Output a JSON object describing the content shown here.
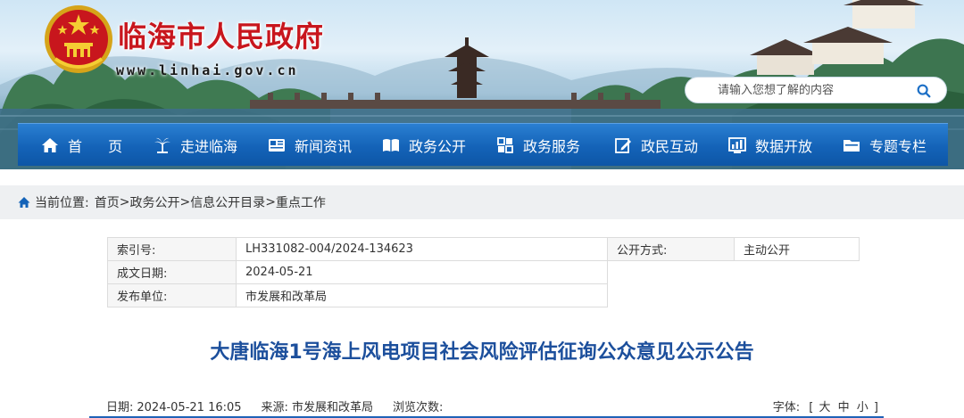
{
  "header": {
    "site_title": "临海市人民政府",
    "site_url": "www.linhai.gov.cn",
    "search": {
      "placeholder": "请输入您想了解的内容"
    }
  },
  "nav": {
    "items": [
      {
        "label": "首 页",
        "icon": "home-icon"
      },
      {
        "label": "走进临海",
        "icon": "palm-tree-icon"
      },
      {
        "label": "新闻资讯",
        "icon": "newspaper-icon"
      },
      {
        "label": "政务公开",
        "icon": "open-book-icon"
      },
      {
        "label": "政务服务",
        "icon": "service-grid-icon"
      },
      {
        "label": "政民互动",
        "icon": "edit-icon"
      },
      {
        "label": "数据开放",
        "icon": "chart-icon"
      },
      {
        "label": "专题专栏",
        "icon": "folder-icon"
      }
    ]
  },
  "breadcrumb": {
    "prefix": "当前位置:",
    "items": [
      "首页",
      "政务公开",
      "信息公开目录",
      "重点工作"
    ],
    "separator": ">"
  },
  "meta": {
    "index_label": "索引号:",
    "index_value": "LH331082-004/2024-134623",
    "public_mode_label": "公开方式:",
    "public_mode_value": "主动公开",
    "date_label": "成文日期:",
    "date_value": "2024-05-21",
    "publisher_label": "发布单位:",
    "publisher_value": "市发展和改革局"
  },
  "article": {
    "title": "大唐临海1号海上风电项目社会风险评估征询公众意见公示公告",
    "date_label": "日期:",
    "date_value": "2024-05-21 16:05",
    "source_label": "来源:",
    "source_value": "市发展和改革局",
    "views_label": "浏览次数:",
    "font_label": "字体:",
    "font_open": "[",
    "font_large": "大",
    "font_medium": "中",
    "font_small": "小",
    "font_close": "]"
  },
  "colors": {
    "title_red": "#c8161d",
    "nav_blue": "#1463b8",
    "article_title_blue": "#1c4f9c",
    "breadcrumb_bg": "#eef0f2"
  }
}
